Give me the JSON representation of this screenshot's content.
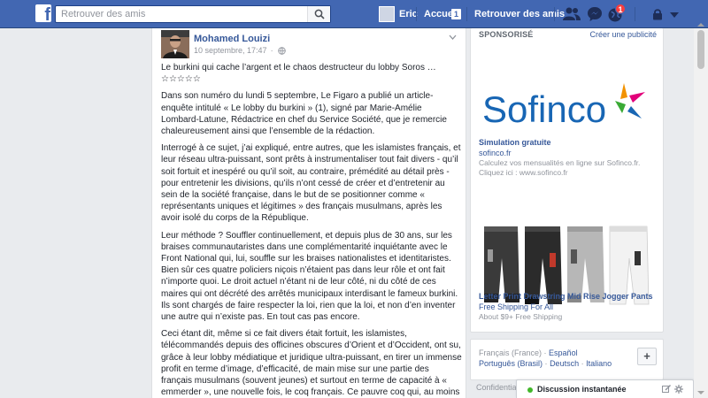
{
  "topbar": {
    "search_placeholder": "Retrouver des amis",
    "user_name": "Eric",
    "home_label": "Accueil",
    "home_count": "1",
    "find_friends_label": "Retrouver des amis",
    "notification_count": "1",
    "logo_letter": "f"
  },
  "post": {
    "author": "Mohamed Louizi",
    "timestamp": "10 septembre, 17:47",
    "separator": "·",
    "paragraphs": [
      "Le burkini qui cache l’argent et le chaos destructeur du lobby Soros … ☆☆☆☆☆",
      "Dans son numéro du lundi 5 septembre, Le Figaro a publié un article-enquête intitulé « Le lobby du burkini » (1), signé par Marie-Amélie Lombard-Latune, Rédactrice en chef du Service Société, que je remercie chaleureusement ainsi que l’ensemble de la rédaction.",
      "Interrogé à ce sujet, j’ai expliqué, entre autres, que les islamistes français, et leur réseau ultra-puissant, sont prêts à instrumentaliser tout fait divers - qu’il soit fortuit et inespéré ou qu’il soit, au contraire, prémédité au détail près - pour entretenir les divisions, qu’ils n’ont cessé de créer et d’entretenir au sein de la société française, dans le but de se positionner comme « représentants uniques et légitimes » des français musulmans, après les avoir isolé du corps de la République.",
      "Leur méthode ? Souffler continuellement, et depuis plus de 30 ans, sur les braises communautaristes dans une complémentarité inquiétante avec le Front National qui, lui, souffle sur les braises nationalistes et identitaristes. Bien sûr ces quatre policiers niçois n’étaient pas dans leur rôle et ont fait n’importe quoi. Le droit actuel n’étant ni de leur côté, ni du côté de ces maires qui ont décrété des arrêtés municipaux interdisant le fameux burkini. Ils sont chargés de faire respecter la loi, rien que la loi, et non d’en inventer une autre qui n’existe pas. En tout cas pas encore.",
      "Ceci étant dit, même si ce fait divers était fortuit, les islamistes, télécommandés depuis des officines obscures d’Orient et d’Occident, ont su, grâce à leur lobby médiatique et juridique ultra-puissant, en tirer un immense profit en terme d’image, d’efficacité, de main mise sur une partie des français musulmans (souvent jeunes) et surtout en terme de capacité à « emmerder », une nouvelle fois, le coq français. Ce pauvre coq qui, au moins"
    ]
  },
  "sponsored": {
    "heading": "SPONSORISÉ",
    "create_ad": "Créer une publicité",
    "ads": [
      {
        "brand": "Sofinco",
        "title": "Simulation gratuite",
        "link": "sofinco.fr",
        "description": "Calculez vos mensualités en ligne sur Sofinco.fr. Cliquez ici : www.sofinco.fr"
      },
      {
        "title": "Letter Print Drawstring Mid Rise Jogger Pants",
        "link": "Free Shipping For All",
        "description": "About $9+ Free Shipping"
      }
    ]
  },
  "languages": {
    "current": "Français (France)",
    "separator": "·",
    "options": [
      "Español",
      "Português (Brasil)",
      "Deutsch",
      "Italiano"
    ],
    "add_label": "+"
  },
  "footer": {
    "text": "Confidentiali"
  },
  "chat": {
    "label": "Discussion instantanée"
  },
  "colors": {
    "brand_blue": "#4267b2",
    "link_blue": "#365899",
    "online_green": "#42b72a",
    "badge_red": "#fa3e3e",
    "sofinco_blue": "#1866b4"
  }
}
